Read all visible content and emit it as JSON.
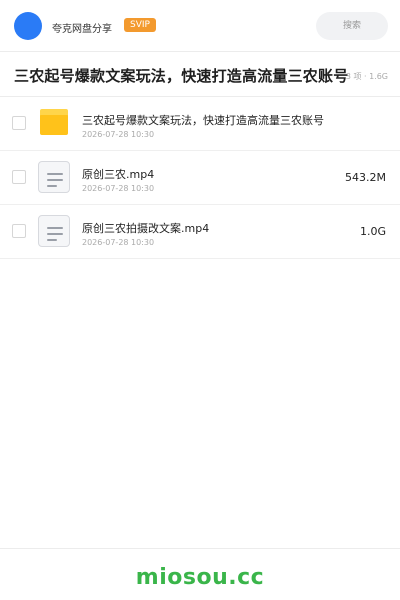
{
  "header": {
    "brand": "夸克网盘分享",
    "badge": "SVIP",
    "search_placeholder": "搜索"
  },
  "share": {
    "title": "三农起号爆款文案玩法，快速打造高流量三农账号",
    "meta": "3 项 · 1.6G"
  },
  "files": [
    {
      "type": "folder",
      "icon": "folder-icon",
      "name": "三农起号爆款文案玩法，快速打造高流量三农账号",
      "date": "2026-07-28 10:30",
      "size": ""
    },
    {
      "type": "video",
      "icon": "document-icon",
      "name": "原创三农.mp4",
      "date": "2026-07-28 10:30",
      "size": "543.2M"
    },
    {
      "type": "video",
      "icon": "document-icon",
      "name": "原创三农拍摄改文案.mp4",
      "date": "2026-07-28 10:30",
      "size": "1.0G"
    }
  ],
  "footer": {
    "watermark": "miosou.cc"
  },
  "colors": {
    "avatar": "#2a7bf6",
    "badge": "#f39a2e",
    "folder": "#ffc21a",
    "watermark": "#3ab54a"
  }
}
